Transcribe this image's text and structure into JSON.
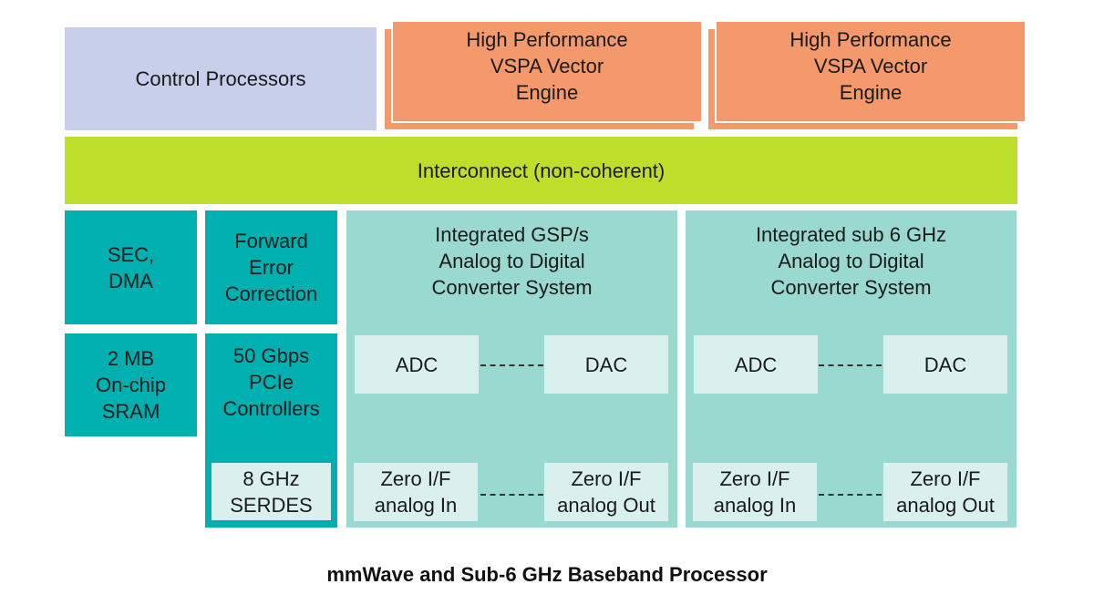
{
  "diagram": {
    "title": "mmWave and Sub-6 GHz Baseband Processor",
    "colors": {
      "control": "#c7cfeb",
      "vector_engine": "#f4996b",
      "interconnect": "#bddf2b",
      "peripheral": "#00b0b0",
      "adc_system": "#99d9cf",
      "sub_block": "#daf0ec"
    },
    "top_row": {
      "control": "Control Processors",
      "vspa_1": "High Performance\nVSPA Vector\nEngine",
      "vspa_2": "High Performance\nVSPA Vector\nEngine"
    },
    "interconnect": "Interconnect (non-coherent)",
    "peripherals": {
      "sec_dma": "SEC,\nDMA",
      "fec": "Forward\nError\nCorrection",
      "sram": "2 MB\nOn-chip\nSRAM",
      "pcie": "50 Gbps\nPCIe\nControllers",
      "serdes": "8 GHz\nSERDES"
    },
    "adc_systems": [
      {
        "title": "Integrated GSP/s\nAnalog to Digital\nConverter System",
        "adc": "ADC",
        "dac": "DAC",
        "zif_in": "Zero I/F\nanalog In",
        "zif_out": "Zero I/F\nanalog Out"
      },
      {
        "title": "Integrated sub 6 GHz\nAnalog to Digital\nConverter System",
        "adc": "ADC",
        "dac": "DAC",
        "zif_in": "Zero I/F\nanalog In",
        "zif_out": "Zero I/F\nanalog Out"
      }
    ]
  }
}
